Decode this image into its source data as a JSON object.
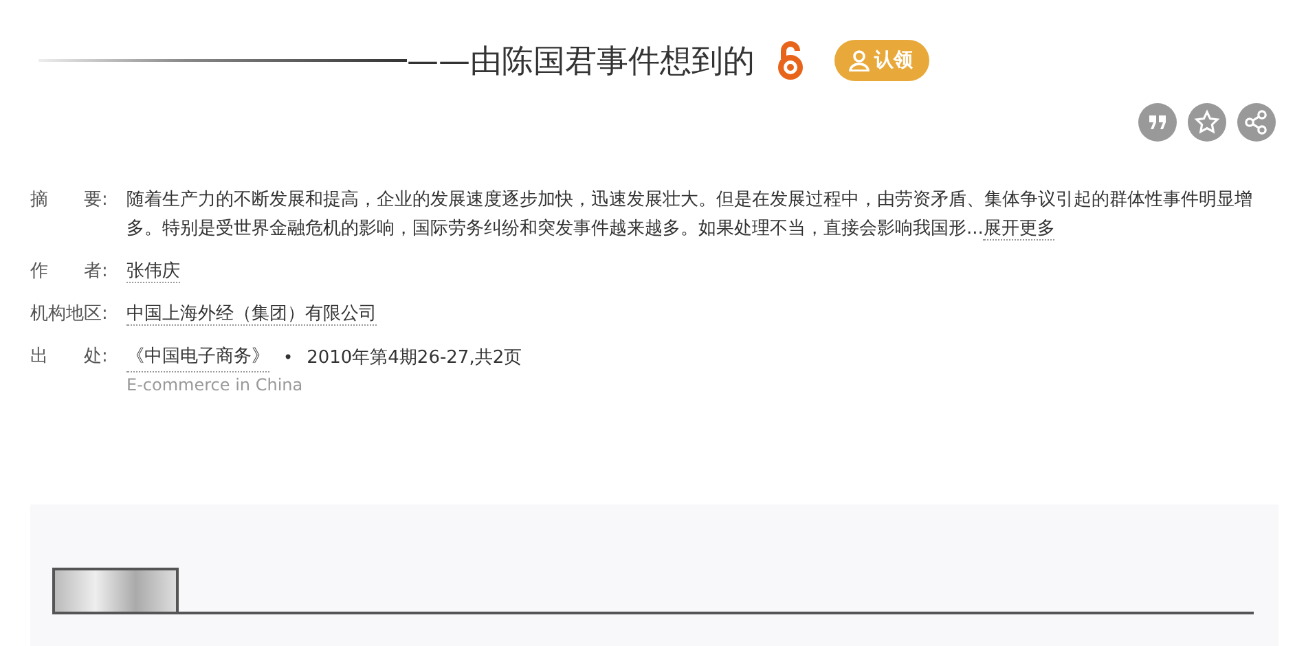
{
  "title": {
    "text": "——由陈国君事件想到的",
    "open_access": true
  },
  "claim_badge": {
    "label": "认领"
  },
  "actions": [
    {
      "kind": "cite"
    },
    {
      "kind": "favorite"
    },
    {
      "kind": "share"
    }
  ],
  "fields": [
    {
      "kind": "abstract",
      "label": "摘　　要:",
      "value": "随着生产力的不断发展和提高，企业的发展速度逐步加快，迅速发展壮大。但是在发展过程中，由劳资矛盾、集体争议引起的群体性事件明显增多。特别是受世界金融危机的影响，国际劳务纠纷和突发事件越来越多。如果处理不当，直接会影响我国形...",
      "more": "展开更多"
    },
    {
      "kind": "link",
      "label": "作　　者:",
      "value": "张伟庆"
    },
    {
      "kind": "link",
      "label": "机构地区:",
      "value": "中国上海外经（集团）有限公司"
    },
    {
      "kind": "source",
      "label": "出　　处:",
      "value": "《中国电子商务》",
      "separator": "•",
      "issue": "2010年第4期26-27,共2页",
      "subtitle": "E-commerce in China"
    }
  ]
}
